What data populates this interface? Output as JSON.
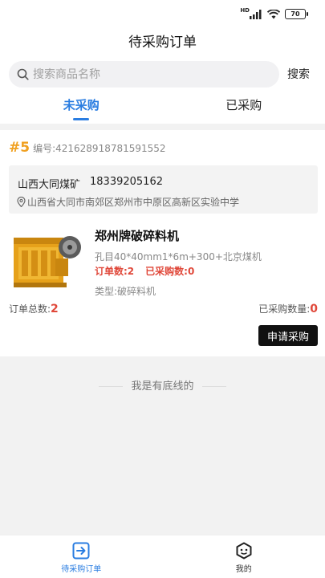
{
  "status_bar": {
    "battery": "70",
    "signal_label": "HD"
  },
  "header": {
    "title": "待采购订单"
  },
  "search": {
    "placeholder": "搜索商品名称",
    "button_label": "搜索"
  },
  "tabs": [
    {
      "label": "未采购",
      "active": true
    },
    {
      "label": "已采购",
      "active": false
    }
  ],
  "order": {
    "number": "#5",
    "code": "编号:421628918781591552",
    "contact_name": "山西大同煤矿",
    "contact_phone": "18339205162",
    "address": "山西省大同市南郊区郑州市中原区高新区实验中学",
    "product": {
      "title": "郑州牌破碎料机",
      "spec": "孔目40*40mm1*6m+300+北京煤机",
      "order_count": "订单数:2",
      "bought_count": "已采购数:0",
      "type": "类型:破碎料机"
    },
    "total_label": "订单总数:",
    "total_value": "2",
    "bought_total_label": "已采购数量:",
    "bought_total_value": "0",
    "apply_button": "申请采购"
  },
  "list_end_text": "我是有底线的",
  "tabbar": [
    {
      "label": "待采购订单",
      "icon": "arrow-square-icon",
      "active": true
    },
    {
      "label": "我的",
      "icon": "hexagon-face-icon",
      "active": false
    }
  ],
  "colors": {
    "accent": "#2a7de1",
    "highlight": "#e0483a",
    "order_number": "#f0a020"
  }
}
